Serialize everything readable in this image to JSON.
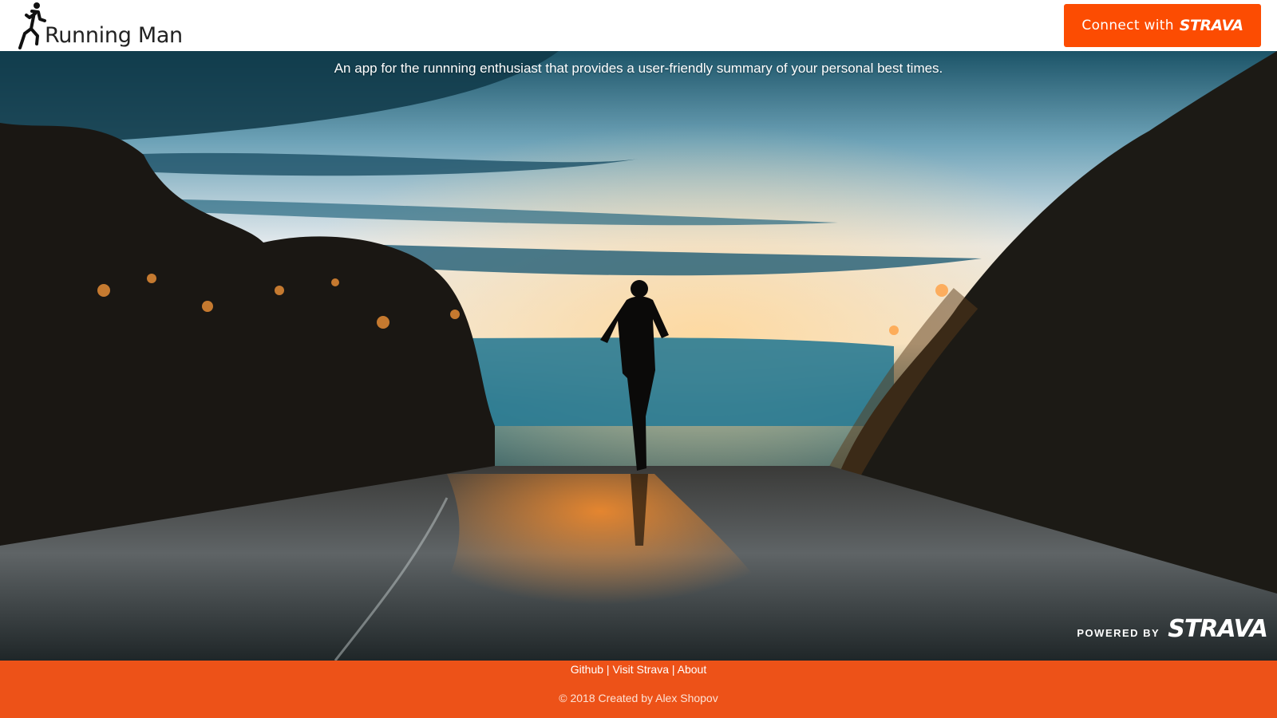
{
  "header": {
    "logo_text": "Running Man",
    "logo_icon": "runner-icon",
    "connect_button": {
      "label": "Connect with",
      "brand": "STRAVA"
    }
  },
  "hero": {
    "tagline": "An app for the runnning enthusiast that provides a user-friendly summary of your personal best times.",
    "image": "runner-on-road-at-sunset",
    "powered_by": {
      "label": "POWERED BY",
      "brand": "STRAVA"
    }
  },
  "footer": {
    "links": [
      "Github",
      "Visit Strava",
      "About"
    ],
    "separator": "|",
    "copyright": "© 2018 Created by Alex Shopov"
  },
  "colors": {
    "strava_orange": "#fc4c02",
    "footer_bg": "#ed5218"
  }
}
